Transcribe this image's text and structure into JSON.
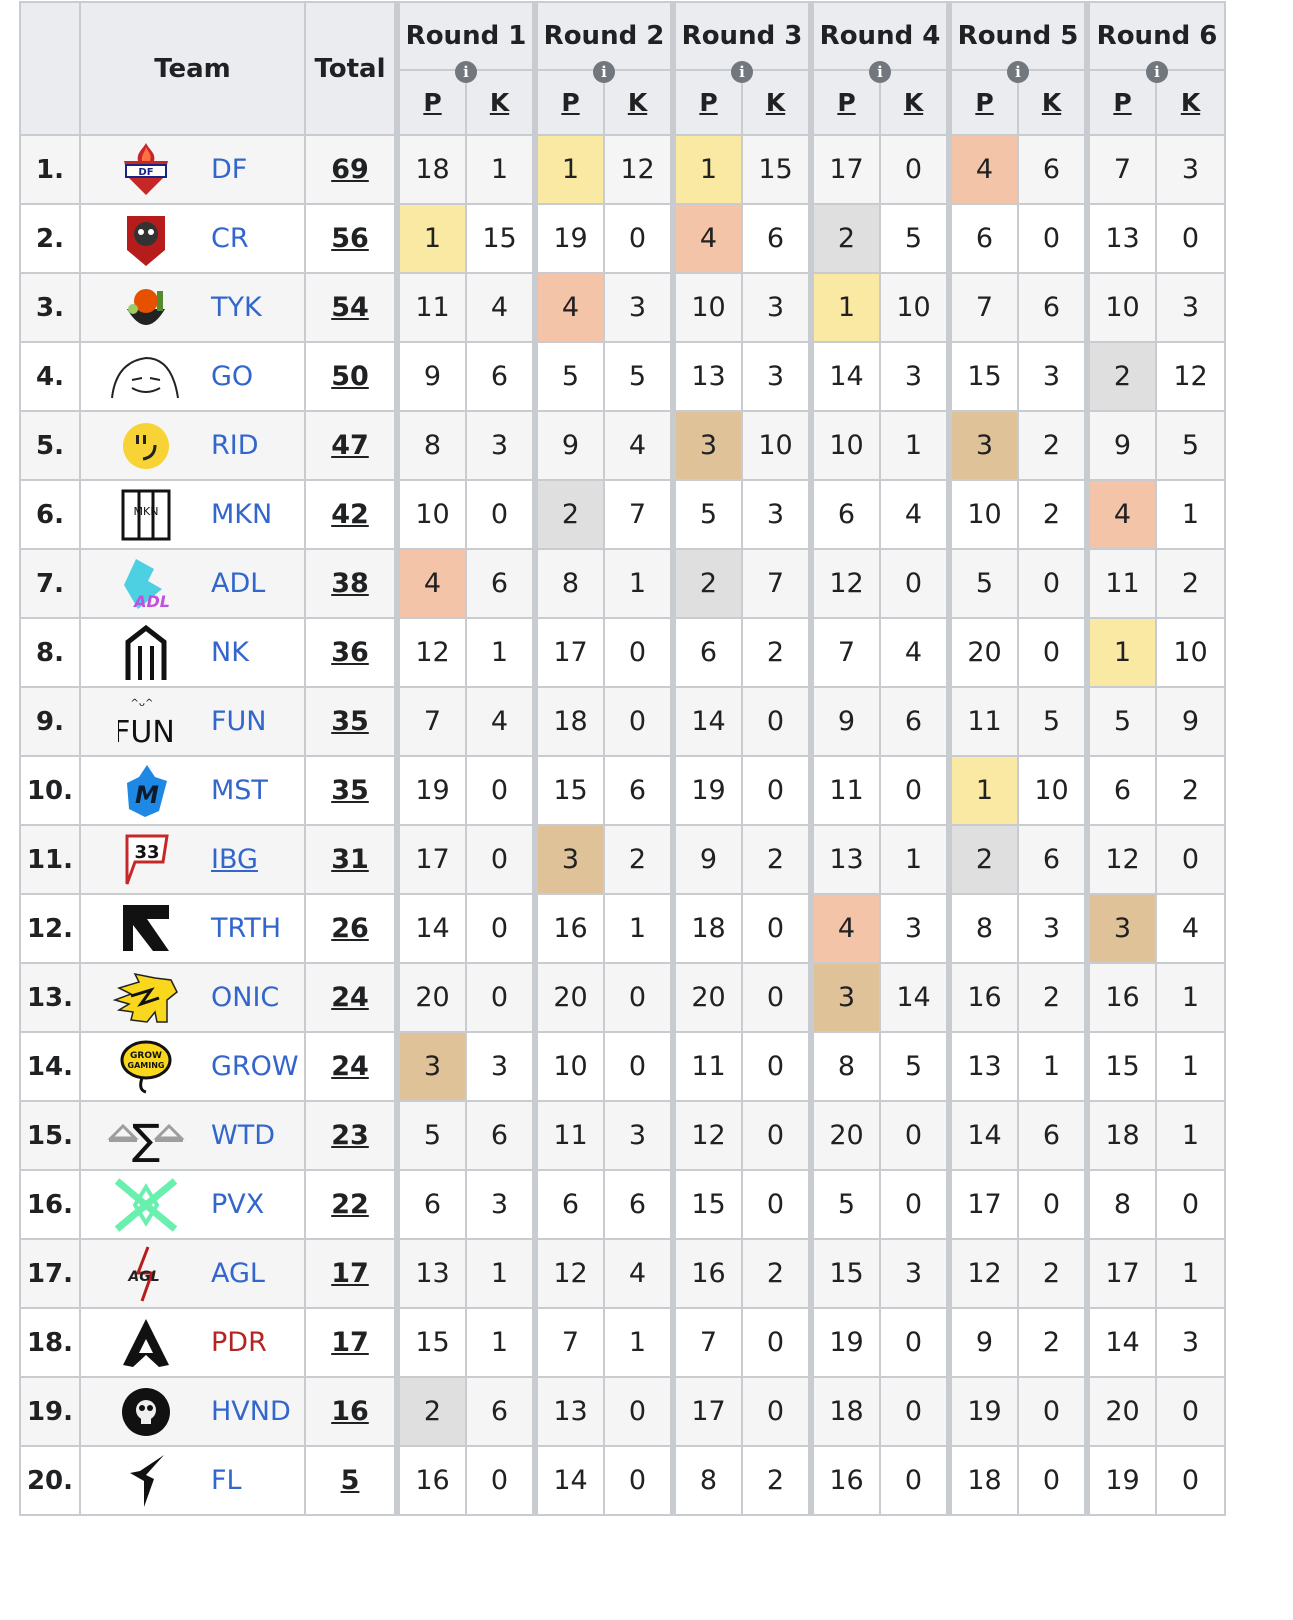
{
  "headers": {
    "team": "Team",
    "total": "Total",
    "rounds": [
      "Round 1",
      "Round 2",
      "Round 3",
      "Round 4",
      "Round 5",
      "Round 6"
    ],
    "placement_abbr": "P",
    "kills_abbr": "K",
    "info_icon": "i"
  },
  "highlight_colors": {
    "place_1": "#fae9a3",
    "place_2": "#dfdfdf",
    "place_3": "#dfc297",
    "place_4": "#f3c4a8"
  },
  "rows": [
    {
      "rank": "1.",
      "team": "DF",
      "logo": "df-logo",
      "total": "69",
      "rounds": [
        [
          18,
          1
        ],
        [
          1,
          12
        ],
        [
          1,
          15
        ],
        [
          17,
          0
        ],
        [
          4,
          6
        ],
        [
          7,
          3
        ]
      ]
    },
    {
      "rank": "2.",
      "team": "CR",
      "logo": "cr-logo",
      "total": "56",
      "rounds": [
        [
          1,
          15
        ],
        [
          19,
          0
        ],
        [
          4,
          6
        ],
        [
          2,
          5
        ],
        [
          6,
          0
        ],
        [
          13,
          0
        ]
      ]
    },
    {
      "rank": "3.",
      "team": "TYK",
      "logo": "tyk-logo",
      "total": "54",
      "rounds": [
        [
          11,
          4
        ],
        [
          4,
          3
        ],
        [
          10,
          3
        ],
        [
          1,
          10
        ],
        [
          7,
          6
        ],
        [
          10,
          3
        ]
      ]
    },
    {
      "rank": "4.",
      "team": "GO",
      "logo": "go-logo",
      "total": "50",
      "rounds": [
        [
          9,
          6
        ],
        [
          5,
          5
        ],
        [
          13,
          3
        ],
        [
          14,
          3
        ],
        [
          15,
          3
        ],
        [
          2,
          12
        ]
      ]
    },
    {
      "rank": "5.",
      "team": "RID",
      "logo": "rid-logo",
      "total": "47",
      "rounds": [
        [
          8,
          3
        ],
        [
          9,
          4
        ],
        [
          3,
          10
        ],
        [
          10,
          1
        ],
        [
          3,
          2
        ],
        [
          9,
          5
        ]
      ]
    },
    {
      "rank": "6.",
      "team": "MKN",
      "logo": "mkn-logo",
      "total": "42",
      "rounds": [
        [
          10,
          0
        ],
        [
          2,
          7
        ],
        [
          5,
          3
        ],
        [
          6,
          4
        ],
        [
          10,
          2
        ],
        [
          4,
          1
        ]
      ]
    },
    {
      "rank": "7.",
      "team": "ADL",
      "logo": "adl-logo",
      "total": "38",
      "rounds": [
        [
          4,
          6
        ],
        [
          8,
          1
        ],
        [
          2,
          7
        ],
        [
          12,
          0
        ],
        [
          5,
          0
        ],
        [
          11,
          2
        ]
      ]
    },
    {
      "rank": "8.",
      "team": "NK",
      "logo": "nk-logo",
      "total": "36",
      "rounds": [
        [
          12,
          1
        ],
        [
          17,
          0
        ],
        [
          6,
          2
        ],
        [
          7,
          4
        ],
        [
          20,
          0
        ],
        [
          1,
          10
        ]
      ]
    },
    {
      "rank": "9.",
      "team": "FUN",
      "logo": "fun-logo",
      "total": "35",
      "rounds": [
        [
          7,
          4
        ],
        [
          18,
          0
        ],
        [
          14,
          0
        ],
        [
          9,
          6
        ],
        [
          11,
          5
        ],
        [
          5,
          9
        ]
      ]
    },
    {
      "rank": "10.",
      "team": "MST",
      "logo": "mst-logo",
      "total": "35",
      "rounds": [
        [
          19,
          0
        ],
        [
          15,
          6
        ],
        [
          19,
          0
        ],
        [
          11,
          0
        ],
        [
          1,
          10
        ],
        [
          6,
          2
        ]
      ]
    },
    {
      "rank": "11.",
      "team": "IBG",
      "logo": "ibg-logo",
      "total": "31",
      "rounds": [
        [
          17,
          0
        ],
        [
          3,
          2
        ],
        [
          9,
          2
        ],
        [
          13,
          1
        ],
        [
          2,
          6
        ],
        [
          12,
          0
        ]
      ]
    },
    {
      "rank": "12.",
      "team": "TRTH",
      "logo": "trth-logo",
      "total": "26",
      "rounds": [
        [
          14,
          0
        ],
        [
          16,
          1
        ],
        [
          18,
          0
        ],
        [
          4,
          3
        ],
        [
          8,
          3
        ],
        [
          3,
          4
        ]
      ]
    },
    {
      "rank": "13.",
      "team": "ONIC",
      "logo": "onic-logo",
      "total": "24",
      "rounds": [
        [
          20,
          0
        ],
        [
          20,
          0
        ],
        [
          20,
          0
        ],
        [
          3,
          14
        ],
        [
          16,
          2
        ],
        [
          16,
          1
        ]
      ]
    },
    {
      "rank": "14.",
      "team": "GROW",
      "logo": "grow-logo",
      "total": "24",
      "rounds": [
        [
          3,
          3
        ],
        [
          10,
          0
        ],
        [
          11,
          0
        ],
        [
          8,
          5
        ],
        [
          13,
          1
        ],
        [
          15,
          1
        ]
      ]
    },
    {
      "rank": "15.",
      "team": "WTD",
      "logo": "wtd-logo",
      "total": "23",
      "rounds": [
        [
          5,
          6
        ],
        [
          11,
          3
        ],
        [
          12,
          0
        ],
        [
          20,
          0
        ],
        [
          14,
          6
        ],
        [
          18,
          1
        ]
      ]
    },
    {
      "rank": "16.",
      "team": "PVX",
      "logo": "pvx-logo",
      "total": "22",
      "rounds": [
        [
          6,
          3
        ],
        [
          6,
          6
        ],
        [
          15,
          0
        ],
        [
          5,
          0
        ],
        [
          17,
          0
        ],
        [
          8,
          0
        ]
      ]
    },
    {
      "rank": "17.",
      "team": "AGL",
      "logo": "agl-logo",
      "total": "17",
      "rounds": [
        [
          13,
          1
        ],
        [
          12,
          4
        ],
        [
          16,
          2
        ],
        [
          15,
          3
        ],
        [
          12,
          2
        ],
        [
          17,
          1
        ]
      ]
    },
    {
      "rank": "18.",
      "team": "PDR",
      "logo": "pdr-logo",
      "total": "17",
      "rounds": [
        [
          15,
          1
        ],
        [
          7,
          1
        ],
        [
          7,
          0
        ],
        [
          19,
          0
        ],
        [
          9,
          2
        ],
        [
          14,
          3
        ]
      ]
    },
    {
      "rank": "19.",
      "team": "HVND",
      "logo": "hvnd-logo",
      "total": "16",
      "rounds": [
        [
          2,
          6
        ],
        [
          13,
          0
        ],
        [
          17,
          0
        ],
        [
          18,
          0
        ],
        [
          19,
          0
        ],
        [
          20,
          0
        ]
      ]
    },
    {
      "rank": "20.",
      "team": "FL",
      "logo": "fl-logo",
      "total": "5",
      "rounds": [
        [
          16,
          0
        ],
        [
          14,
          0
        ],
        [
          8,
          2
        ],
        [
          16,
          0
        ],
        [
          18,
          0
        ],
        [
          19,
          0
        ]
      ]
    }
  ],
  "team_link_styles": {
    "IBG": "underlined",
    "PDR": "red"
  }
}
